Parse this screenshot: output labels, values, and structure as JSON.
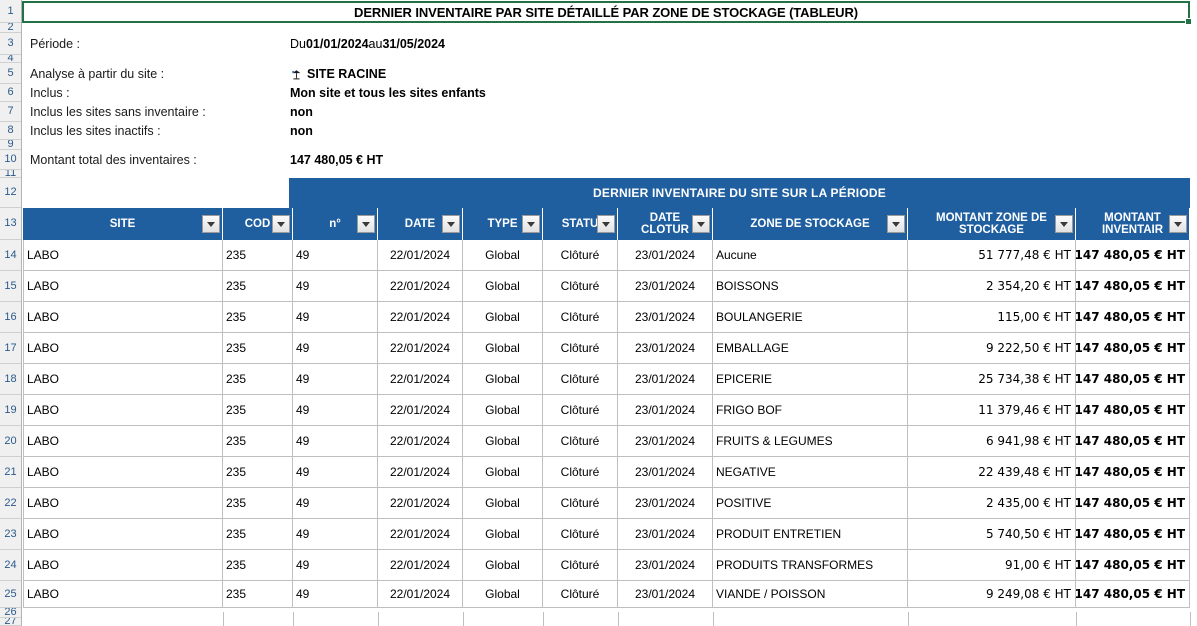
{
  "document": {
    "title": "DERNIER INVENTAIRE PAR SITE DÉTAILLÉ PAR ZONE DE STOCKAGE (TABLEUR)"
  },
  "row_headers": [
    "1",
    "2",
    "3",
    "4",
    "5",
    "6",
    "7",
    "8",
    "9",
    "10",
    "11",
    "12",
    "13",
    "14",
    "15",
    "16",
    "17",
    "18",
    "19",
    "20",
    "21",
    "22",
    "23",
    "24",
    "25",
    "26",
    "27"
  ],
  "summary": [
    {
      "label": "Période :",
      "value_prefix": "Du ",
      "value_b1": "01/01/2024",
      "value_mid": " au ",
      "value_b2": "31/05/2024"
    },
    {
      "label": "Analyse à partir du site :",
      "value": "SITE RACINE",
      "icon": "site-tree-icon"
    },
    {
      "label": "Inclus :",
      "value": "Mon site et tous les sites enfants"
    },
    {
      "label": "Inclus les sites sans inventaire :",
      "value": "non"
    },
    {
      "label": "Inclus les sites inactifs :",
      "value": "non"
    },
    {
      "label": "Montant total des inventaires :",
      "value": "147 480,05 € HT"
    }
  ],
  "table": {
    "group_header": "DERNIER INVENTAIRE DU SITE SUR LA PÉRIODE",
    "columns": [
      {
        "label": "SITE",
        "display": "SITE"
      },
      {
        "label": "CODE",
        "display": "COD"
      },
      {
        "label": "n°",
        "display": "n°"
      },
      {
        "label": "DATE",
        "display": "DATE"
      },
      {
        "label": "TYPE",
        "display": "TYPE"
      },
      {
        "label": "STATUT",
        "display": "STATU"
      },
      {
        "label": "DATE CLOTURE",
        "display": "DATE\nCLOTUR"
      },
      {
        "label": "ZONE DE STOCKAGE",
        "display": "ZONE DE STOCKAGE"
      },
      {
        "label": "MONTANT ZONE DE STOCKAGE",
        "display": "MONTANT ZONE DE\nSTOCKAGE"
      },
      {
        "label": "MONTANT INVENTAIRE",
        "display": "MONTANT\nINVENTAIR"
      }
    ],
    "rows": [
      {
        "site": "LABO",
        "code": "235",
        "num": "49",
        "date": "22/01/2024",
        "type": "Global",
        "statut": "Clôturé",
        "date_cloture": "23/01/2024",
        "zone": "Aucune",
        "montant_zone": "51 777,48 € HT",
        "montant_inventaire": "147 480,05 € HT"
      },
      {
        "site": "LABO",
        "code": "235",
        "num": "49",
        "date": "22/01/2024",
        "type": "Global",
        "statut": "Clôturé",
        "date_cloture": "23/01/2024",
        "zone": "BOISSONS",
        "montant_zone": "2 354,20 € HT",
        "montant_inventaire": "147 480,05 € HT"
      },
      {
        "site": "LABO",
        "code": "235",
        "num": "49",
        "date": "22/01/2024",
        "type": "Global",
        "statut": "Clôturé",
        "date_cloture": "23/01/2024",
        "zone": "BOULANGERIE",
        "montant_zone": "115,00 € HT",
        "montant_inventaire": "147 480,05 € HT"
      },
      {
        "site": "LABO",
        "code": "235",
        "num": "49",
        "date": "22/01/2024",
        "type": "Global",
        "statut": "Clôturé",
        "date_cloture": "23/01/2024",
        "zone": "EMBALLAGE",
        "montant_zone": "9 222,50 € HT",
        "montant_inventaire": "147 480,05 € HT"
      },
      {
        "site": "LABO",
        "code": "235",
        "num": "49",
        "date": "22/01/2024",
        "type": "Global",
        "statut": "Clôturé",
        "date_cloture": "23/01/2024",
        "zone": "EPICERIE",
        "montant_zone": "25 734,38 € HT",
        "montant_inventaire": "147 480,05 € HT"
      },
      {
        "site": "LABO",
        "code": "235",
        "num": "49",
        "date": "22/01/2024",
        "type": "Global",
        "statut": "Clôturé",
        "date_cloture": "23/01/2024",
        "zone": "FRIGO BOF",
        "montant_zone": "11 379,46 € HT",
        "montant_inventaire": "147 480,05 € HT"
      },
      {
        "site": "LABO",
        "code": "235",
        "num": "49",
        "date": "22/01/2024",
        "type": "Global",
        "statut": "Clôturé",
        "date_cloture": "23/01/2024",
        "zone": "FRUITS & LEGUMES",
        "montant_zone": "6 941,98 € HT",
        "montant_inventaire": "147 480,05 € HT"
      },
      {
        "site": "LABO",
        "code": "235",
        "num": "49",
        "date": "22/01/2024",
        "type": "Global",
        "statut": "Clôturé",
        "date_cloture": "23/01/2024",
        "zone": "NEGATIVE",
        "montant_zone": "22 439,48 € HT",
        "montant_inventaire": "147 480,05 € HT"
      },
      {
        "site": "LABO",
        "code": "235",
        "num": "49",
        "date": "22/01/2024",
        "type": "Global",
        "statut": "Clôturé",
        "date_cloture": "23/01/2024",
        "zone": "POSITIVE",
        "montant_zone": "2 435,00 € HT",
        "montant_inventaire": "147 480,05 € HT"
      },
      {
        "site": "LABO",
        "code": "235",
        "num": "49",
        "date": "22/01/2024",
        "type": "Global",
        "statut": "Clôturé",
        "date_cloture": "23/01/2024",
        "zone": "PRODUIT ENTRETIEN",
        "montant_zone": "5 740,50 € HT",
        "montant_inventaire": "147 480,05 € HT"
      },
      {
        "site": "LABO",
        "code": "235",
        "num": "49",
        "date": "22/01/2024",
        "type": "Global",
        "statut": "Clôturé",
        "date_cloture": "23/01/2024",
        "zone": "PRODUITS TRANSFORMES",
        "montant_zone": "91,00 € HT",
        "montant_inventaire": "147 480,05 € HT"
      },
      {
        "site": "LABO",
        "code": "235",
        "num": "49",
        "date": "22/01/2024",
        "type": "Global",
        "statut": "Clôturé",
        "date_cloture": "23/01/2024",
        "zone": "VIANDE / POISSON",
        "montant_zone": "9 249,08 € HT",
        "montant_inventaire": "147 480,05 € HT"
      }
    ]
  },
  "colors": {
    "header_blue": "#1F5FA0",
    "selection_green": "#217346",
    "gridline": "#bfbfbf",
    "rowhead_bg": "#f0f0f0"
  }
}
